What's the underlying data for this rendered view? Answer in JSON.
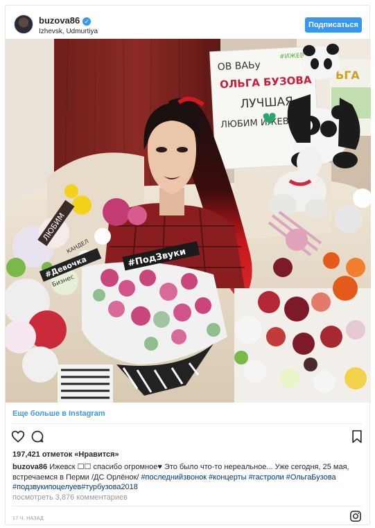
{
  "header": {
    "username": "buzova86",
    "location": "Izhevsk, Udmurtiya",
    "follow_label": "Подписаться"
  },
  "photo": {
    "sign_lines": [
      "ОВ ВАЬу",
      "ОЛЬГА БУЗОВА",
      "ЛУЧШАЯ",
      "ЛЮБИМ ИЖЕВСК"
    ],
    "sign_small": "#ИЖЕВСК",
    "right_sign": "ЬГА",
    "bouquet_tag": "#ПодЗвуки",
    "left_tag": "#Девочка",
    "left_tag2": "Бизнес",
    "left_tag3": "КАНДЕЛ",
    "left_word": "ЛЮБИМ"
  },
  "more_link": "Еще больше в Instagram",
  "stats": {
    "likes": "197,421 отметок «Нравится»"
  },
  "caption": {
    "user": "buzova86",
    "text": " Ижевск ☐☐ спасибо огромное♥ Это было что-то нереальное... Уже сегодня, 25 мая, встречаемся в Перми /ДС Орлёнок/ ",
    "tags": "#последнийзвонок #концерты #гастроли #ОльгаБузова #подзвукипоцелуев#турбузова2018"
  },
  "comments_link": "посмотреть 3,876 комментариев",
  "timestamp": "17 Ч. НАЗАД",
  "colors": {
    "accent": "#3897f0",
    "hashtag": "#003569",
    "muted": "#999999"
  },
  "icons": [
    "heart-icon",
    "comment-icon",
    "bookmark-icon",
    "instagram-icon",
    "verified-icon"
  ]
}
